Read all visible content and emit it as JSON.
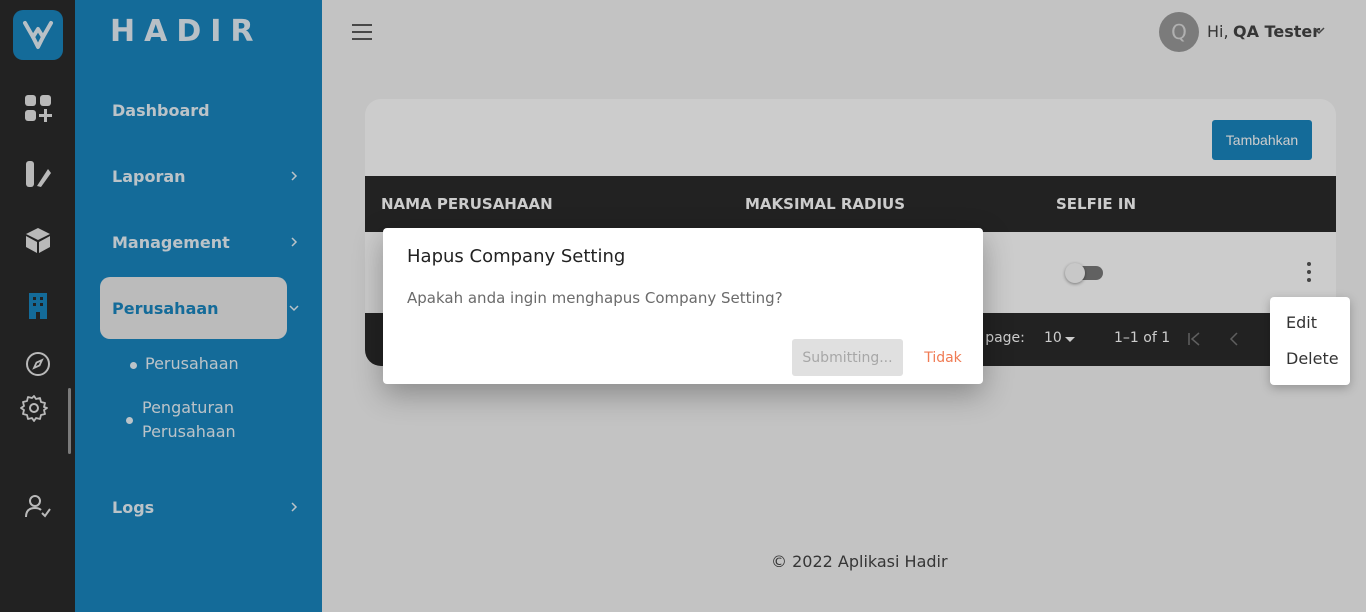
{
  "app": {
    "brand": "HADIR"
  },
  "colors": {
    "primary": "#1a86c0",
    "rail": "#2b2b2b",
    "danger": "#f07b54"
  },
  "sidebar": {
    "items": [
      {
        "label": "Dashboard",
        "has_chevron": false
      },
      {
        "label": "Laporan",
        "has_chevron": true
      },
      {
        "label": "Management",
        "has_chevron": true
      },
      {
        "label": "Perusahaan",
        "has_chevron": true,
        "active": true
      },
      {
        "label": "Logs",
        "has_chevron": true
      }
    ],
    "sub_items": [
      {
        "label": "Perusahaan"
      },
      {
        "label_line1": "Pengaturan",
        "label_line2": "Perusahaan"
      }
    ]
  },
  "rail_icons": [
    "grid-plus-icon",
    "report-icon",
    "cube-icon",
    "building-icon",
    "compass-icon",
    "gear-icon",
    "user-check-icon"
  ],
  "header": {
    "avatar_initial": "Q",
    "greeting": "Hi,",
    "username": "QA Tester"
  },
  "card": {
    "add_button": "Tambahkan",
    "columns": [
      "NAMA PERUSAHAAN",
      "MAKSIMAL RADIUS",
      "SELFIE IN"
    ],
    "pagination": {
      "rows_label": "r page:",
      "rows_value": "10",
      "range": "1–1 of 1"
    }
  },
  "row_menu": {
    "items": [
      "Edit",
      "Delete"
    ]
  },
  "dialog": {
    "title": "Hapus Company Setting",
    "message": "Apakah anda ingin menghapus Company Setting?",
    "submit_label": "Submitting...",
    "cancel_label": "Tidak"
  },
  "footer": {
    "copyright": "© 2022 Aplikasi Hadir"
  }
}
